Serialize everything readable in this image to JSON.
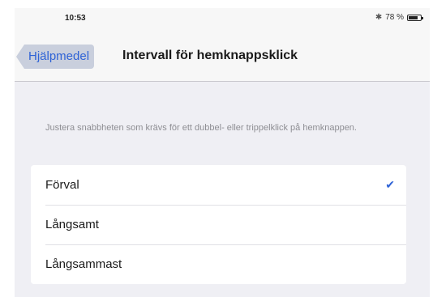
{
  "status_bar": {
    "time": "10:53",
    "battery_text": "78 %",
    "battery_level": 0.78,
    "bluetooth_icon": "bluetooth-icon",
    "battery_icon": "battery-icon"
  },
  "navbar": {
    "back_label": "Hjälpmedel",
    "title": "Intervall för hemknappsklick"
  },
  "description": "Justera snabbheten som krävs för ett dubbel- eller trippelklick på hemknappen.",
  "options": [
    {
      "label": "Förval",
      "selected": true
    },
    {
      "label": "Långsamt",
      "selected": false
    },
    {
      "label": "Långsammast",
      "selected": false
    }
  ],
  "colors": {
    "accent": "#2f63d6",
    "background": "#efeff4"
  }
}
